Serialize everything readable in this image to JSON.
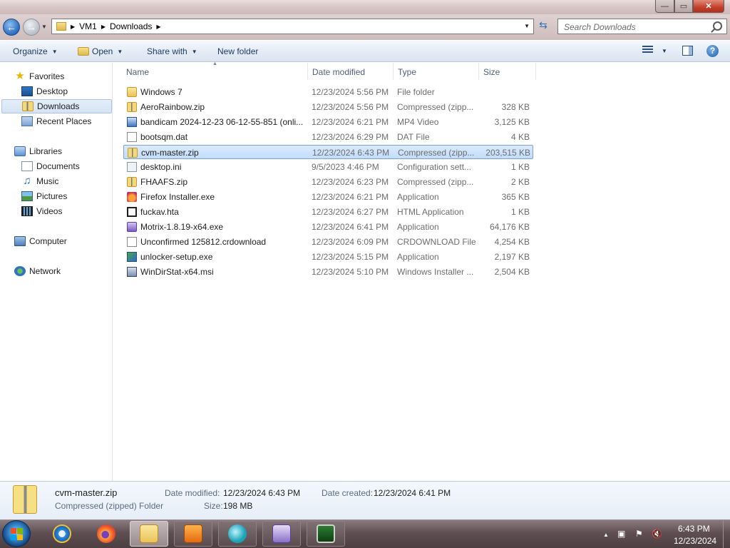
{
  "window": {
    "minimize_glyph": "—",
    "maximize_glyph": "▭",
    "close_glyph": "✕"
  },
  "address": {
    "crumbs": [
      "VM1",
      "Downloads"
    ],
    "search_placeholder": "Search Downloads"
  },
  "toolbar": {
    "organize": "Organize",
    "open": "Open",
    "share_with": "Share with",
    "new_folder": "New folder",
    "help": "?"
  },
  "nav": {
    "favorites": "Favorites",
    "desktop": "Desktop",
    "downloads": "Downloads",
    "recent_places": "Recent Places",
    "libraries": "Libraries",
    "documents": "Documents",
    "music": "Music",
    "pictures": "Pictures",
    "videos": "Videos",
    "computer": "Computer",
    "network": "Network"
  },
  "columns": {
    "name": "Name",
    "date_modified": "Date modified",
    "type": "Type",
    "size": "Size"
  },
  "files": [
    {
      "name": "Windows 7",
      "date": "12/23/2024 5:56 PM",
      "type": "File folder",
      "size": "",
      "icon": "folder-icon"
    },
    {
      "name": "AeroRainbow.zip",
      "date": "12/23/2024 5:56 PM",
      "type": "Compressed (zipp...",
      "size": "328 KB",
      "icon": "zip-icon"
    },
    {
      "name": "bandicam 2024-12-23 06-12-55-851 (onli...",
      "date": "12/23/2024 6:21 PM",
      "type": "MP4 Video",
      "size": "3,125 KB",
      "icon": "video-file-icon"
    },
    {
      "name": "bootsqm.dat",
      "date": "12/23/2024 6:29 PM",
      "type": "DAT File",
      "size": "4 KB",
      "icon": "blank-file-icon"
    },
    {
      "name": "cvm-master.zip",
      "date": "12/23/2024 6:43 PM",
      "type": "Compressed (zipp...",
      "size": "203,515 KB",
      "icon": "zip-icon"
    },
    {
      "name": "desktop.ini",
      "date": "9/5/2023 4:46 PM",
      "type": "Configuration sett...",
      "size": "1 KB",
      "icon": "settings-file-icon"
    },
    {
      "name": "FHAAFS.zip",
      "date": "12/23/2024 6:23 PM",
      "type": "Compressed (zipp...",
      "size": "2 KB",
      "icon": "zip-icon"
    },
    {
      "name": "Firefox Installer.exe",
      "date": "12/23/2024 6:21 PM",
      "type": "Application",
      "size": "365 KB",
      "icon": "firefox-icon"
    },
    {
      "name": "fuckav.hta",
      "date": "12/23/2024 6:27 PM",
      "type": "HTML Application",
      "size": "1 KB",
      "icon": "hta-file-icon"
    },
    {
      "name": "Motrix-1.8.19-x64.exe",
      "date": "12/23/2024 6:41 PM",
      "type": "Application",
      "size": "64,176 KB",
      "icon": "motrix-icon"
    },
    {
      "name": "Unconfirmed 125812.crdownload",
      "date": "12/23/2024 6:09 PM",
      "type": "CRDOWNLOAD File",
      "size": "4,254 KB",
      "icon": "blank-file-icon"
    },
    {
      "name": "unlocker-setup.exe",
      "date": "12/23/2024 5:15 PM",
      "type": "Application",
      "size": "2,197 KB",
      "icon": "installer-icon"
    },
    {
      "name": "WinDirStat-x64.msi",
      "date": "12/23/2024 5:10 PM",
      "type": "Windows Installer ...",
      "size": "2,504 KB",
      "icon": "msi-icon"
    }
  ],
  "selected_index": 4,
  "details": {
    "name": "cvm-master.zip",
    "type": "Compressed (zipped) Folder",
    "date_modified_label": "Date modified:",
    "date_modified": "12/23/2024 6:43 PM",
    "size_label": "Size:",
    "size": "198 MB",
    "date_created_label": "Date created:",
    "date_created": "12/23/2024 6:41 PM"
  },
  "taskbar": {
    "time": "6:43 PM",
    "date": "12/23/2024",
    "apps": [
      "internet-explorer-icon",
      "firefox-icon",
      "file-explorer-icon",
      "media-player-icon",
      "chat-app-icon",
      "floppy-app-icon",
      "terminal-app-icon"
    ]
  },
  "colors": {
    "selection": "#cce3fb",
    "accent": "#1e395b"
  }
}
